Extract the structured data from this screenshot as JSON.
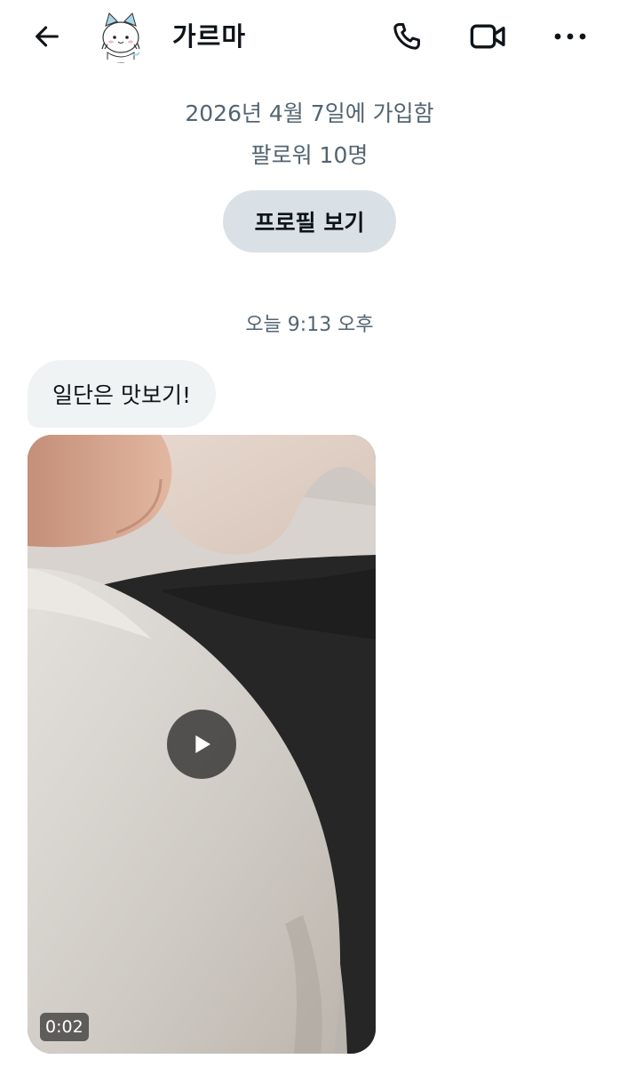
{
  "header": {
    "title": "가르마",
    "back_icon": "arrow-left-icon",
    "call_icon": "phone-icon",
    "video_icon": "video-camera-icon",
    "more_icon": "more-horizontal-icon"
  },
  "profile_info": {
    "joined": "2026년 4월 7일에 가입함",
    "followers": "팔로워 10명",
    "view_profile_label": "프로필 보기"
  },
  "conversation": {
    "timestamp": "오늘 9:13 오후",
    "messages": [
      {
        "type": "text",
        "text": "일단은 맛보기!"
      },
      {
        "type": "video",
        "duration": "0:02",
        "play_icon": "play-icon"
      }
    ]
  },
  "colors": {
    "text_primary": "#0f1419",
    "text_secondary": "#536471",
    "bubble_bg": "#eff3f4",
    "profile_button_bg": "#d9e1e7",
    "avatar_accent": "#a9d6ea"
  }
}
